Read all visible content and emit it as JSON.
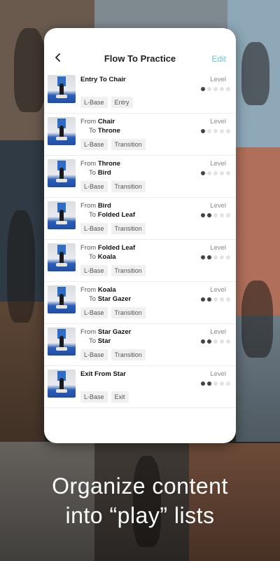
{
  "header": {
    "title": "Flow To Practice",
    "edit_label": "Edit"
  },
  "labels": {
    "from": "From",
    "to": "To",
    "level": "Level"
  },
  "items": [
    {
      "title": "Entry To Chair",
      "tags": [
        "L-Base",
        "Entry"
      ],
      "level": 1
    },
    {
      "from": "Chair",
      "to": "Throne",
      "tags": [
        "L-Base",
        "Transition"
      ],
      "level": 1
    },
    {
      "from": "Throne",
      "to": "Bird",
      "tags": [
        "L-Base",
        "Transition"
      ],
      "level": 1
    },
    {
      "from": "Bird",
      "to": "Folded Leaf",
      "tags": [
        "L-Base",
        "Transition"
      ],
      "level": 2
    },
    {
      "from": "Folded Leaf",
      "to": "Koala",
      "tags": [
        "L-Base",
        "Transition"
      ],
      "level": 2
    },
    {
      "from": "Koala",
      "to": "Star Gazer",
      "tags": [
        "L-Base",
        "Transition"
      ],
      "level": 2
    },
    {
      "from": "Star Gazer",
      "to": "Star",
      "tags": [
        "L-Base",
        "Transition"
      ],
      "level": 2
    },
    {
      "title": "Exit From Star",
      "tags": [
        "L-Base",
        "Exit"
      ],
      "level": 2
    }
  ],
  "level_max": 5,
  "caption": {
    "line1": "Organize content",
    "line2": "into “play” lists"
  },
  "colors": {
    "accent": "#6cc2e6",
    "dot_on": "#444444",
    "dot_off": "#e3e3e3"
  }
}
